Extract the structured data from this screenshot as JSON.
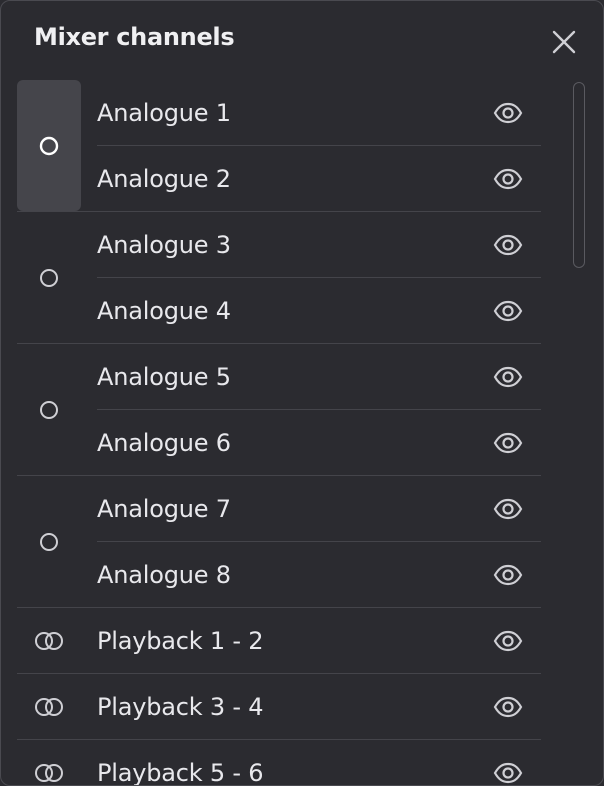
{
  "panel": {
    "title": "Mixer channels"
  },
  "icons": {
    "mono": "circle-icon",
    "stereo": "double-circle-icon",
    "visibility": "eye-icon",
    "close": "close-icon"
  },
  "colors": {
    "background": "#2b2b30",
    "selected_group": "#45454b",
    "divider": "#44444a",
    "text": "#e8e8ec",
    "icon": "#cfcfd4"
  },
  "groups": [
    {
      "type": "mono",
      "selected": true,
      "channels": [
        {
          "label": "Analogue 1"
        },
        {
          "label": "Analogue 2"
        }
      ]
    },
    {
      "type": "mono",
      "selected": false,
      "channels": [
        {
          "label": "Analogue 3"
        },
        {
          "label": "Analogue 4"
        }
      ]
    },
    {
      "type": "mono",
      "selected": false,
      "channels": [
        {
          "label": "Analogue 5"
        },
        {
          "label": "Analogue 6"
        }
      ]
    },
    {
      "type": "mono",
      "selected": false,
      "channels": [
        {
          "label": "Analogue 7"
        },
        {
          "label": "Analogue 8"
        }
      ]
    },
    {
      "type": "stereo",
      "selected": false,
      "channels": [
        {
          "label": "Playback 1 - 2"
        }
      ]
    },
    {
      "type": "stereo",
      "selected": false,
      "channels": [
        {
          "label": "Playback 3 - 4"
        }
      ]
    },
    {
      "type": "stereo",
      "selected": false,
      "channels": [
        {
          "label": "Playback 5 - 6"
        }
      ]
    }
  ]
}
